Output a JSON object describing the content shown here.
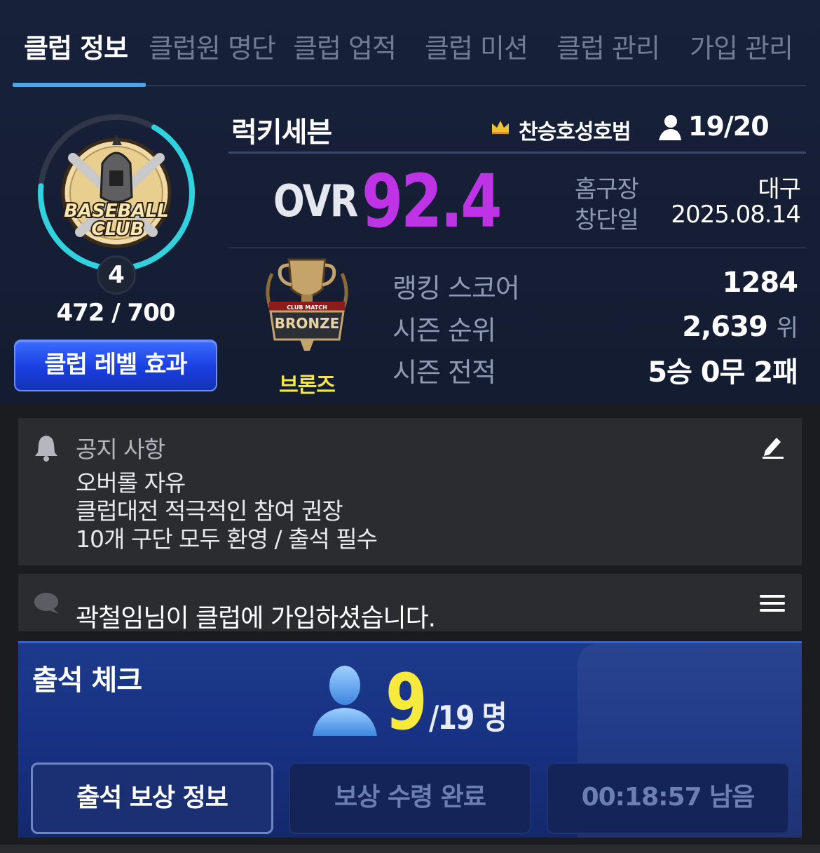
{
  "tabs": [
    {
      "label": "클럽 정보",
      "active": true
    },
    {
      "label": "클럽원 명단",
      "active": false
    },
    {
      "label": "클럽 업적",
      "active": false
    },
    {
      "label": "클럽 미션",
      "active": false
    },
    {
      "label": "클럽 관리",
      "active": false
    },
    {
      "label": "가입 관리",
      "active": false
    }
  ],
  "club": {
    "emblem_text_1": "BASEBALL",
    "emblem_text_2": "CLUB",
    "level": "4",
    "exp": "472 / 700",
    "level_effect_button": "클럽 레벨 효과",
    "name": "럭키세븐",
    "master": "찬승호성호범",
    "members": "19/20",
    "ovr_label": "OVR",
    "ovr_value": "92.4",
    "home_label": "홈구장",
    "home_value": "대구",
    "founded_label": "창단일",
    "founded_value": "2025.08.14"
  },
  "ranking": {
    "tier": "브론즈",
    "trophy_text": "BRONZE",
    "trophy_small": "CLUB MATCH",
    "score_label": "랭킹 스코어",
    "score_value": "1284",
    "rank_label": "시즌 순위",
    "rank_value": "2,639",
    "rank_unit": "위",
    "record_label": "시즌 전적",
    "record_value": "5승 0무 2패"
  },
  "notice": {
    "title": "공지 사항",
    "lines": [
      "오버롤 자유",
      "클럽대전 적극적인 참여 권장",
      "10개 구단 모두 환영 / 출석 필수"
    ]
  },
  "chat": {
    "message": "곽철임님이 클럽에 가입하셨습니다."
  },
  "attendance": {
    "title": "출석 체크",
    "count": "9",
    "total": "/19 명",
    "reward_info_button": "출석 보상 정보",
    "reward_done_button": "보상 수령 완료",
    "timer_button": "00:18:57 남음"
  },
  "colors": {
    "accent": "#4aa6e8",
    "ovr": "#bf33e6",
    "tier": "#f3e745",
    "attendance_count": "#f7ea3c"
  }
}
